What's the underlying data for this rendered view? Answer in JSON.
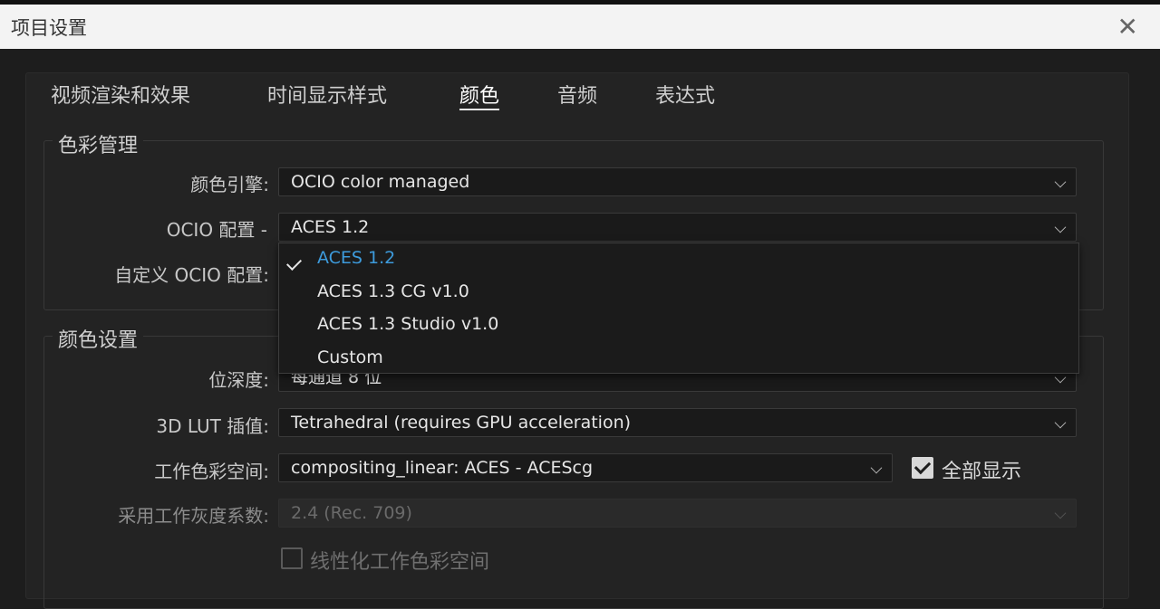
{
  "window": {
    "title": "项目设置",
    "close_label": "✕"
  },
  "tabs": [
    {
      "label": "视频渲染和效果",
      "active": false
    },
    {
      "label": "时间显示样式",
      "active": false
    },
    {
      "label": "颜色",
      "active": true
    },
    {
      "label": "音频",
      "active": false
    },
    {
      "label": "表达式",
      "active": false
    }
  ],
  "color_management": {
    "title": "色彩管理",
    "engine_label": "颜色引擎:",
    "engine_value": "OCIO color managed",
    "ocio_config_label": "OCIO 配置 -",
    "ocio_config_value": "ACES 1.2",
    "custom_config_label": "自定义 OCIO 配置:"
  },
  "ocio_menu": {
    "items": [
      {
        "label": "ACES 1.2",
        "selected": true
      },
      {
        "label": "ACES 1.3 CG v1.0",
        "selected": false
      },
      {
        "label": "ACES 1.3 Studio v1.0",
        "selected": false
      },
      {
        "label": "Custom",
        "selected": false
      }
    ]
  },
  "color_settings": {
    "title": "颜色设置",
    "bit_depth_label": "位深度:",
    "bit_depth_value": "每通道 8 位",
    "lut_label": "3D LUT 插值:",
    "lut_value": "Tetrahedral (requires GPU acceleration)",
    "working_space_label": "工作色彩空间:",
    "working_space_value": "compositing_linear: ACES - ACEScg",
    "show_all_label": "全部显示",
    "show_all_checked": true,
    "gamma_label": "采用工作灰度系数:",
    "gamma_value": "2.4 (Rec. 709)",
    "linearize_label": "线性化工作色彩空间",
    "linearize_checked": false
  },
  "colors": {
    "accent": "#3d9bdc",
    "background": "#1d1d1d",
    "panel": "#232323"
  }
}
